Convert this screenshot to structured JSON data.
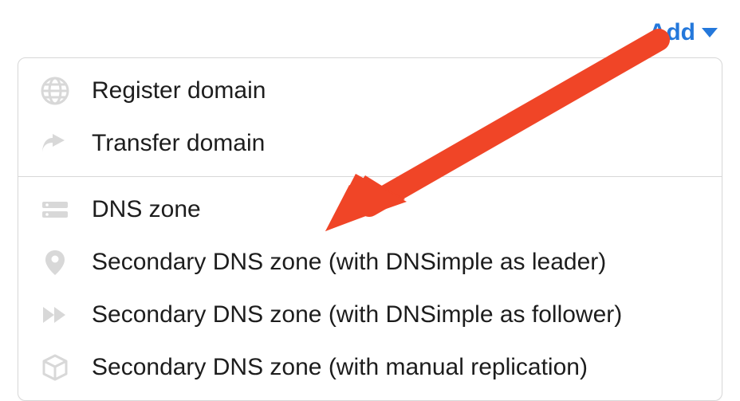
{
  "add_button": {
    "label": "Add"
  },
  "menu": {
    "section1": [
      {
        "icon": "globe-icon",
        "label": "Register domain"
      },
      {
        "icon": "share-icon",
        "label": "Transfer domain"
      }
    ],
    "section2": [
      {
        "icon": "server-icon",
        "label": "DNS zone"
      },
      {
        "icon": "pin-icon",
        "label": "Secondary DNS zone (with DNSimple as leader)"
      },
      {
        "icon": "fast-forward-icon",
        "label": "Secondary DNS zone (with DNSimple as follower)"
      },
      {
        "icon": "cube-icon",
        "label": "Secondary DNS zone (with manual replication)"
      }
    ]
  },
  "annotation": {
    "arrow_color": "#f04527"
  }
}
